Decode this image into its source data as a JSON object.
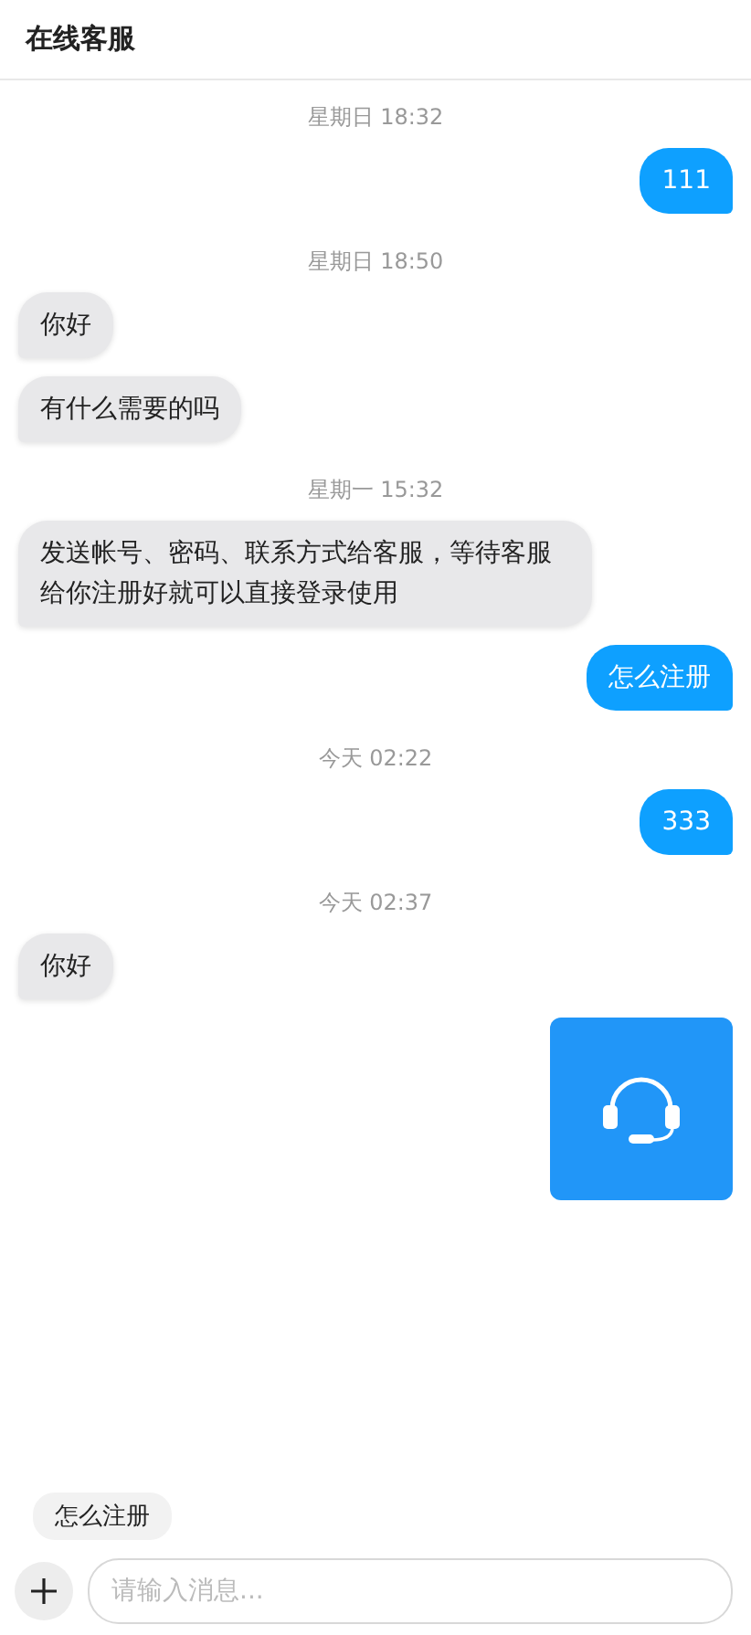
{
  "header": {
    "title": "在线客服"
  },
  "messages": [
    {
      "kind": "time",
      "text": "星期日 18:32"
    },
    {
      "kind": "text",
      "outgoing": true,
      "text": "111"
    },
    {
      "kind": "time",
      "text": "星期日 18:50"
    },
    {
      "kind": "text",
      "outgoing": false,
      "text": "你好"
    },
    {
      "kind": "text",
      "outgoing": false,
      "text": "有什么需要的吗"
    },
    {
      "kind": "time",
      "text": "星期一 15:32"
    },
    {
      "kind": "text",
      "outgoing": false,
      "text": "发送帐号、密码、联系方式给客服，等待客服给你注册好就可以直接登录使用"
    },
    {
      "kind": "text",
      "outgoing": true,
      "text": "怎么注册"
    },
    {
      "kind": "time",
      "text": "今天 02:22"
    },
    {
      "kind": "text",
      "outgoing": true,
      "text": "333"
    },
    {
      "kind": "time",
      "text": "今天 02:37"
    },
    {
      "kind": "text",
      "outgoing": false,
      "text": "你好"
    },
    {
      "kind": "image",
      "outgoing": true
    }
  ],
  "quick_replies": [
    "怎么注册"
  ],
  "composer": {
    "placeholder": "请输入消息..."
  }
}
